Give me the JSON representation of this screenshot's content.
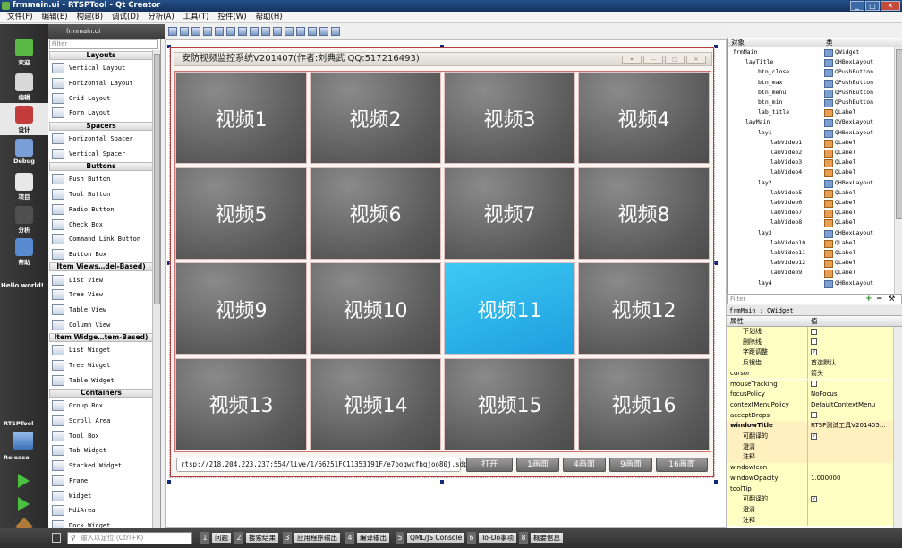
{
  "window": {
    "title": "frmmain.ui - RTSPTool - Qt Creator"
  },
  "menu": [
    "文件(F)",
    "编辑(E)",
    "构建(B)",
    "调试(D)",
    "分析(A)",
    "工具(T)",
    "控件(W)",
    "帮助(H)"
  ],
  "modes": [
    {
      "label": "欢迎",
      "icon": "qt-logo-icon"
    },
    {
      "label": "编辑",
      "icon": "edit-icon"
    },
    {
      "label": "设计",
      "icon": "design-icon"
    },
    {
      "label": "Debug",
      "icon": "debug-icon"
    },
    {
      "label": "项目",
      "icon": "project-icon"
    },
    {
      "label": "分析",
      "icon": "analyze-icon"
    },
    {
      "label": "帮助",
      "icon": "help-icon"
    }
  ],
  "modebar": {
    "hello": "Hello world!",
    "project": "RTSPTool",
    "build": "Release"
  },
  "editor": {
    "file_tab": "frmmain.ui"
  },
  "widgetbox": {
    "filter_placeholder": "Filter",
    "groups": [
      {
        "title": "Layouts",
        "items": [
          "Vertical Layout",
          "Horizontal Layout",
          "Grid Layout",
          "Form Layout"
        ]
      },
      {
        "title": "Spacers",
        "items": [
          "Horizontal Spacer",
          "Vertical Spacer"
        ]
      },
      {
        "title": "Buttons",
        "items": [
          "Push Button",
          "Tool Button",
          "Radio Button",
          "Check Box",
          "Command Link Button",
          "Button Box"
        ]
      },
      {
        "title": "Item Views…del-Based)",
        "items": [
          "List View",
          "Tree View",
          "Table View",
          "Column View"
        ]
      },
      {
        "title": "Item Widge…tem-Based)",
        "items": [
          "List Widget",
          "Tree Widget",
          "Table Widget"
        ]
      },
      {
        "title": "Containers",
        "items": [
          "Group Box",
          "Scroll Area",
          "Tool Box",
          "Tab Widget",
          "Stacked Widget",
          "Frame",
          "Widget",
          "MdiArea",
          "Dock Widget"
        ]
      }
    ]
  },
  "form": {
    "title": "安防视频监控系统V201407(作者:刘典武 QQ:517216493)",
    "videos": [
      "视频1",
      "视频2",
      "视频3",
      "视频4",
      "视频5",
      "视频6",
      "视频7",
      "视频8",
      "视频9",
      "视频10",
      "视频11",
      "视频12",
      "视频13",
      "视频14",
      "视频15",
      "视频16"
    ],
    "selected_video": "视频11",
    "url": "rtsp://218.204.223.237:554/live/1/66251FC11353191F/e7ooqwcfbqjoo80j.sdp",
    "buttons": [
      "打开",
      "1画面",
      "4画面",
      "9画面",
      "16画面"
    ],
    "colors": {
      "selected": "#1f9ede",
      "cell": "#5a5a5a"
    }
  },
  "objects": {
    "header": [
      "对象",
      "类"
    ],
    "rows": [
      {
        "name": "frmMain",
        "class": "QWidget",
        "level": 0
      },
      {
        "name": "layTitle",
        "class": "QHBoxLayout",
        "level": 1
      },
      {
        "name": "btn_close",
        "class": "QPushButton",
        "level": 2
      },
      {
        "name": "btn_max",
        "class": "QPushButton",
        "level": 2
      },
      {
        "name": "btn_menu",
        "class": "QPushButton",
        "level": 2
      },
      {
        "name": "btn_min",
        "class": "QPushButton",
        "level": 2
      },
      {
        "name": "lab_title",
        "class": "QLabel",
        "level": 2
      },
      {
        "name": "layMain",
        "class": "QVBoxLayout",
        "level": 1
      },
      {
        "name": "lay1",
        "class": "QHBoxLayout",
        "level": 2
      },
      {
        "name": "labVideo1",
        "class": "QLabel",
        "level": 3
      },
      {
        "name": "labVideo2",
        "class": "QLabel",
        "level": 3
      },
      {
        "name": "labVideo3",
        "class": "QLabel",
        "level": 3
      },
      {
        "name": "labVideo4",
        "class": "QLabel",
        "level": 3
      },
      {
        "name": "lay2",
        "class": "QHBoxLayout",
        "level": 2
      },
      {
        "name": "labVideo5",
        "class": "QLabel",
        "level": 3
      },
      {
        "name": "labVideo6",
        "class": "QLabel",
        "level": 3
      },
      {
        "name": "labVideo7",
        "class": "QLabel",
        "level": 3
      },
      {
        "name": "labVideo8",
        "class": "QLabel",
        "level": 3
      },
      {
        "name": "lay3",
        "class": "QHBoxLayout",
        "level": 2
      },
      {
        "name": "labVideo10",
        "class": "QLabel",
        "level": 3
      },
      {
        "name": "labVideo11",
        "class": "QLabel",
        "level": 3
      },
      {
        "name": "labVideo12",
        "class": "QLabel",
        "level": 3
      },
      {
        "name": "labVideo9",
        "class": "QLabel",
        "level": 3
      },
      {
        "name": "lay4",
        "class": "QHBoxLayout",
        "level": 2
      }
    ]
  },
  "properties": {
    "filter_placeholder": "Filter",
    "object_label": "frmMain : QWidget",
    "header": [
      "属性",
      "值"
    ],
    "rows": [
      {
        "name": "下划线",
        "value": "",
        "check": "off",
        "sub": true
      },
      {
        "name": "删除线",
        "value": "",
        "check": "off",
        "sub": true
      },
      {
        "name": "字距调整",
        "value": "",
        "check": "on",
        "sub": true
      },
      {
        "name": "反锯齿",
        "value": "首选默认",
        "sub": true
      },
      {
        "name": "cursor",
        "value": "箭头"
      },
      {
        "name": "mouseTracking",
        "value": "",
        "check": "off"
      },
      {
        "name": "focusPolicy",
        "value": "NoFocus"
      },
      {
        "name": "contextMenuPolicy",
        "value": "DefaultContextMenu"
      },
      {
        "name": "acceptDrops",
        "value": "",
        "check": "off"
      },
      {
        "name": "windowTitle",
        "value": "RTSP测试工具V201405…",
        "bold": true,
        "tone": "o"
      },
      {
        "name": "可翻译的",
        "value": "",
        "check": "on",
        "sub": true,
        "tone": "o"
      },
      {
        "name": "澄清",
        "value": "",
        "sub": true,
        "tone": "o"
      },
      {
        "name": "注释",
        "value": "",
        "sub": true,
        "tone": "o"
      },
      {
        "name": "windowIcon",
        "value": ""
      },
      {
        "name": "windowOpacity",
        "value": "1.000000"
      },
      {
        "name": "toolTip",
        "value": ""
      },
      {
        "name": "可翻译的",
        "value": "",
        "check": "on",
        "sub": true
      },
      {
        "name": "澄清",
        "value": "",
        "sub": true
      },
      {
        "name": "注释",
        "value": "",
        "sub": true
      }
    ]
  },
  "statusbar": {
    "locate_placeholder": "输入以定位 (Ctrl+K)",
    "panes": [
      {
        "n": "1",
        "label": "问题"
      },
      {
        "n": "2",
        "label": "搜索结果"
      },
      {
        "n": "3",
        "label": "应用程序输出"
      },
      {
        "n": "4",
        "label": "编译输出"
      },
      {
        "n": "5",
        "label": "QML/JS Console"
      },
      {
        "n": "6",
        "label": "To-Do事项"
      },
      {
        "n": "8",
        "label": "概要信息"
      }
    ]
  }
}
